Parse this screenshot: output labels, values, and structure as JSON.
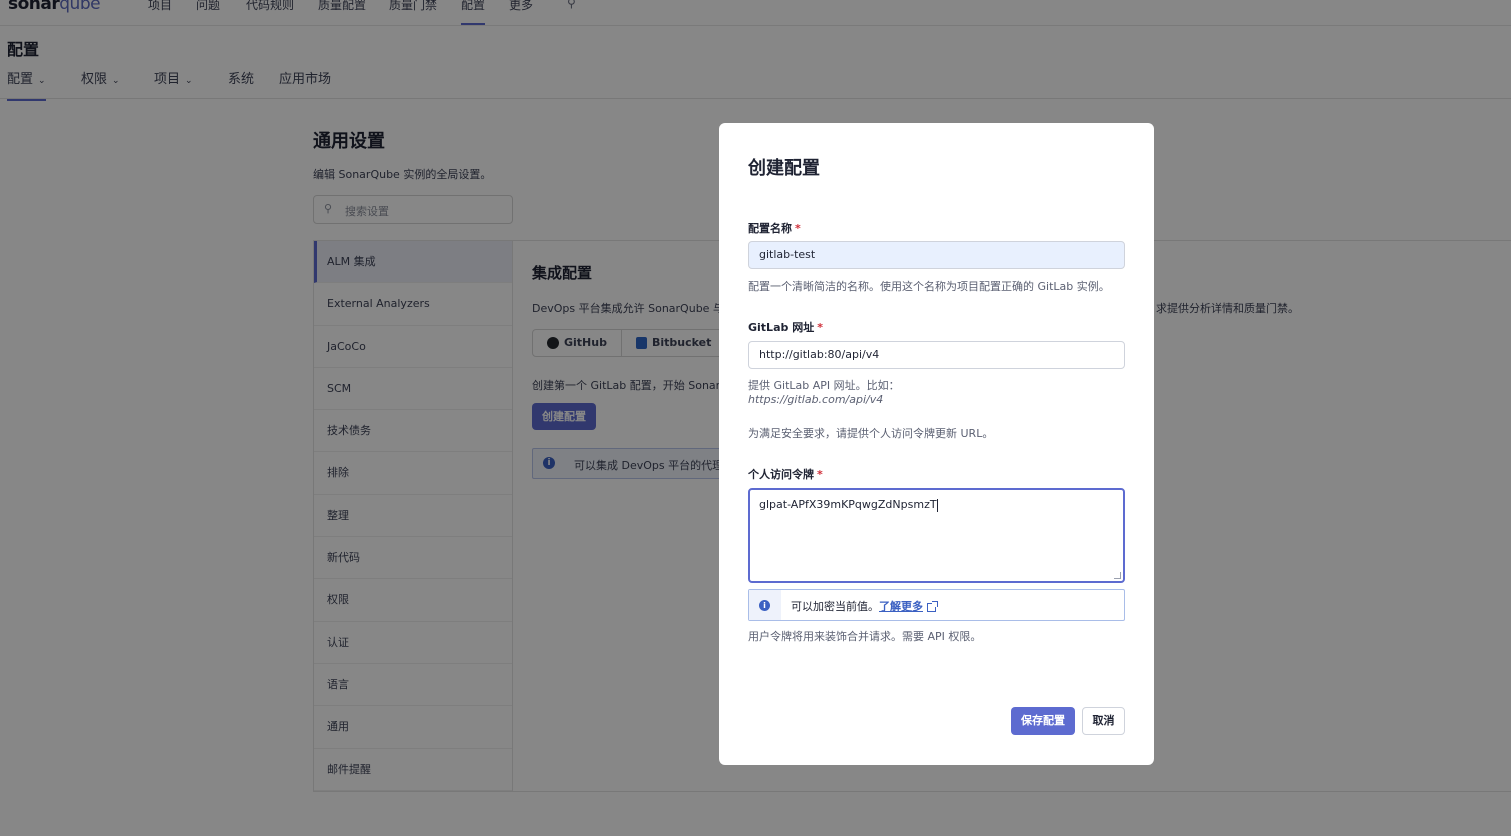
{
  "topnav": {
    "logo_text": "sonar",
    "logo_suffix": "qube",
    "items": [
      "项目",
      "问题",
      "代码规则",
      "质量配置",
      "质量门禁",
      "配置",
      "更多"
    ],
    "active_item": "配置",
    "search_icon": "search-icon"
  },
  "subheader": {
    "title": "配置",
    "tabs": [
      {
        "label": "配置",
        "has_dropdown": true,
        "active": true
      },
      {
        "label": "权限",
        "has_dropdown": true,
        "active": false
      },
      {
        "label": "项目",
        "has_dropdown": true,
        "active": false
      },
      {
        "label": "系统",
        "has_dropdown": false,
        "active": false
      },
      {
        "label": "应用市场",
        "has_dropdown": false,
        "active": false
      }
    ]
  },
  "settings": {
    "title": "通用设置",
    "description": "编辑 SonarQube 实例的全局设置。",
    "search_placeholder": "搜索设置",
    "categories": [
      "ALM 集成",
      "External Analyzers",
      "JaCoCo",
      "SCM",
      "技术债务",
      "排除",
      "整理",
      "新代码",
      "权限",
      "认证",
      "语言",
      "通用",
      "邮件提醒"
    ],
    "active_category": "ALM 集成"
  },
  "content": {
    "title": "集成配置",
    "description_left": "DevOps 平台集成允许 SonarQube 与",
    "description_right": "求提供分析详情和质量门禁。",
    "alm_tabs": [
      "GitHub",
      "Bitbucket"
    ],
    "create_description": "创建第一个 GitLab 配置，开始 Sonar",
    "create_button": "创建配置",
    "info_text": "可以集成 DevOps 平台的代理"
  },
  "modal": {
    "title": "创建配置",
    "name_field": {
      "label": "配置名称",
      "required_mark": "*",
      "value": "gitlab-test",
      "help": "配置一个清晰简洁的名称。使用这个名称为项目配置正确的 GitLab 实例。"
    },
    "url_field": {
      "label": "GitLab 网址",
      "required_mark": "*",
      "value": "http://gitlab:80/api/v4",
      "help_line1": "提供 GitLab API 网址。比如：",
      "help_example": "https://gitlab.com/api/v4",
      "help_line2": "为满足安全要求，请提供个人访问令牌更新 URL。"
    },
    "token_field": {
      "label": "个人访问令牌",
      "required_mark": "*",
      "value": "glpat-APfX39mKPqwgZdNpsmzT",
      "encrypt_note": "可以加密当前值。",
      "learn_more": "了解更多",
      "help": "用户令牌将用来装饰合并请求。需要 API 权限。"
    },
    "save_button": "保存配置",
    "cancel_button": "取消"
  },
  "colors": {
    "accent": "#5d6bd0",
    "info": "#3b60c2",
    "required": "#d02f3a",
    "overlay": "rgba(0,0,0,0.47)"
  }
}
